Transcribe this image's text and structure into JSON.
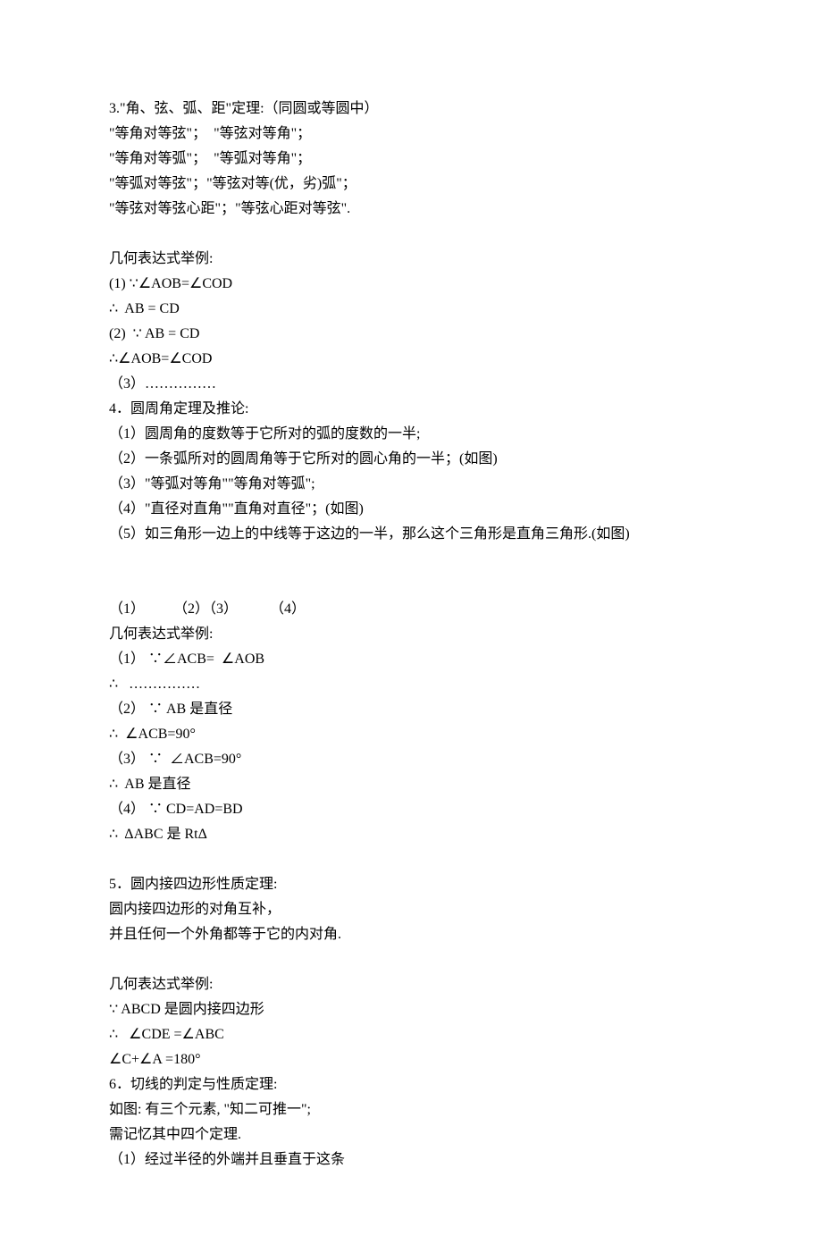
{
  "section3": {
    "title": "3.\"角、弦、弧、距\"定理:（同圆或等圆中）",
    "lines": [
      "\"等角对等弦\"；  \"等弦对等角\"；",
      "\"等角对等弧\"；  \"等弧对等角\"；",
      "\"等弧对等弦\"；\"等弦对等(优，劣)弧\"；",
      "\"等弦对等弦心距\"；\"等弦心距对等弦\"."
    ],
    "example_title": "几何表达式举例:",
    "examples": [
      "(1) ∵∠AOB=∠COD",
      "∴  AB = CD",
      "(2)  ∵ AB = CD",
      "∴∠AOB=∠COD",
      "（3）……………"
    ]
  },
  "section4": {
    "title": "4．圆周角定理及推论:",
    "lines": [
      "（1）圆周角的度数等于它所对的弧的度数的一半;",
      "（2）一条弧所对的圆周角等于它所对的圆心角的一半；(如图)",
      "（3）\"等弧对等角\"\"等角对等弧\";",
      "（4）\"直径对直角\"\"直角对直径\"；(如图)",
      "（5）如三角形一边上的中线等于这边的一半，那么这个三角形是直角三角形.(如图)"
    ],
    "figrow": "（1）        （2）（3）         （4）",
    "example_title": "几何表达式举例:",
    "examples": [
      "（1） ∵∠ACB=  ∠AOB",
      "∴   ……………",
      "（2） ∵ AB 是直径",
      "∴  ∠ACB=90°",
      "（3） ∵  ∠ACB=90°",
      "∴  AB 是直径",
      "（4） ∵ CD=AD=BD",
      "∴  ΔABC 是 RtΔ"
    ]
  },
  "section5": {
    "title": "5．圆内接四边形性质定理:",
    "lines": [
      "圆内接四边形的对角互补，",
      "并且任何一个外角都等于它的内对角."
    ],
    "example_title": "几何表达式举例:",
    "examples": [
      "∵ ABCD 是圆内接四边形",
      "∴   ∠CDE =∠ABC",
      "∠C+∠A =180°"
    ]
  },
  "section6": {
    "title": "6．切线的判定与性质定理:",
    "lines": [
      "如图: 有三个元素, \"知二可推一\";",
      "需记忆其中四个定理.",
      "（1）经过半径的外端并且垂直于这条"
    ]
  }
}
